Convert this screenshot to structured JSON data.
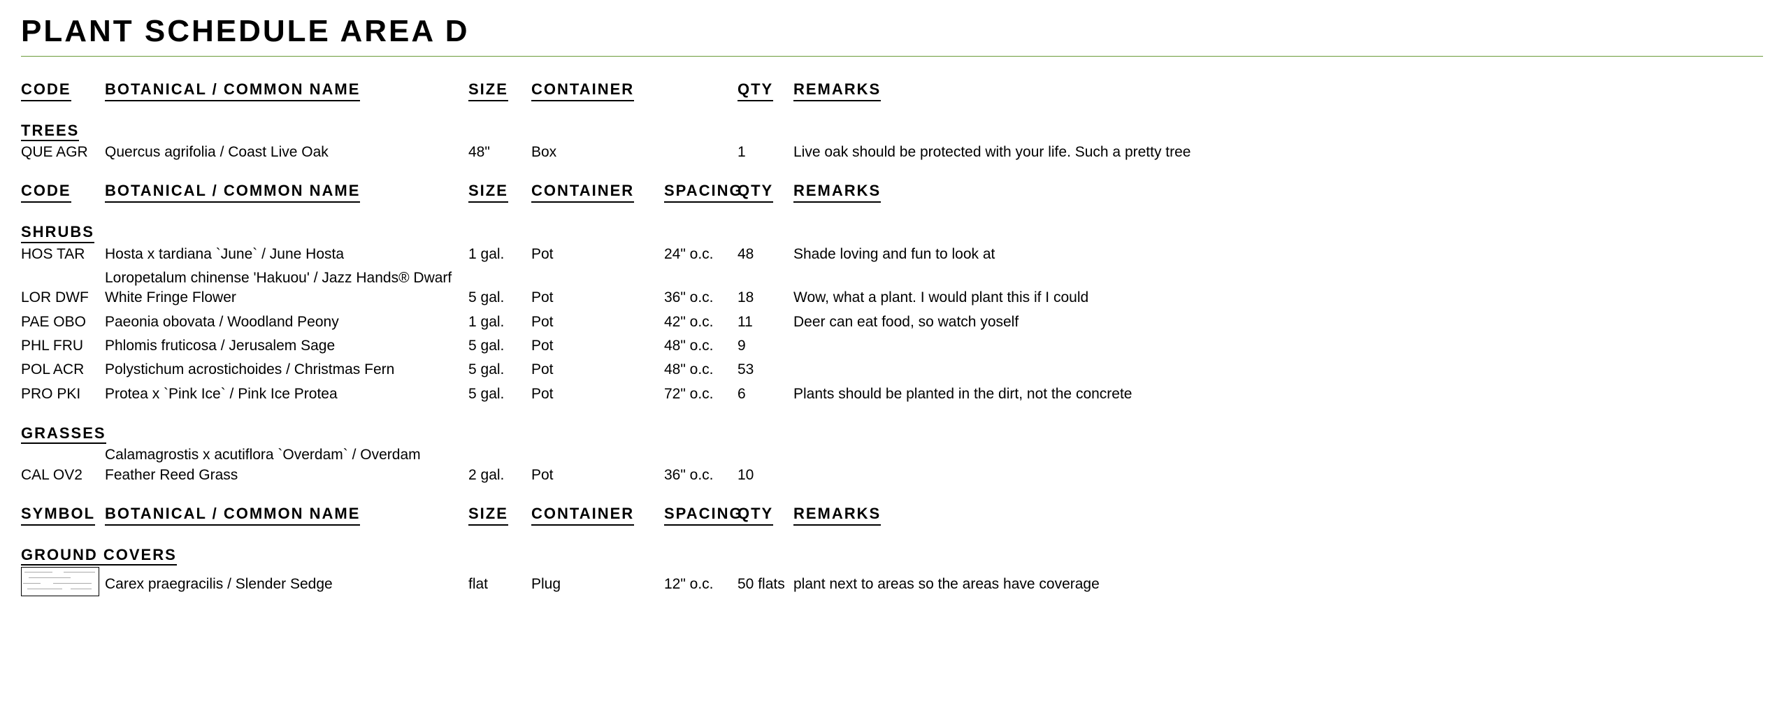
{
  "title": "PLANT SCHEDULE AREA D",
  "headers": {
    "code": "CODE",
    "symbol": "SYMBOL",
    "name": "BOTANICAL / COMMON NAME",
    "size": "SIZE",
    "container": "CONTAINER",
    "spacing": "SPACING",
    "qty": "QTY",
    "remarks": "REMARKS"
  },
  "sections": {
    "trees": {
      "label": "TREES",
      "rows": [
        {
          "code": "QUE AGR",
          "name": "Quercus agrifolia / Coast Live Oak",
          "size": "48\"",
          "container": "Box",
          "spacing": "",
          "qty": "1",
          "remarks": "Live oak should be protected with your life. Such a pretty tree"
        }
      ]
    },
    "shrubs": {
      "label": "SHRUBS",
      "rows": [
        {
          "code": "HOS TAR",
          "name": "Hosta x tardiana `June` / June Hosta",
          "size": "1 gal.",
          "container": "Pot",
          "spacing": "24\" o.c.",
          "qty": "48",
          "remarks": "Shade loving and fun to look at"
        },
        {
          "code": "LOR DWF",
          "name": "Loropetalum chinense 'Hakuou' / Jazz Hands® Dwarf White Fringe Flower",
          "size": "5 gal.",
          "container": "Pot",
          "spacing": "36\" o.c.",
          "qty": "18",
          "remarks": "Wow, what a plant. I would plant this if I could"
        },
        {
          "code": "PAE OBO",
          "name": "Paeonia obovata / Woodland Peony",
          "size": "1 gal.",
          "container": "Pot",
          "spacing": "42\" o.c.",
          "qty": "11",
          "remarks": "Deer can eat food, so watch yoself"
        },
        {
          "code": "PHL FRU",
          "name": "Phlomis fruticosa / Jerusalem Sage",
          "size": "5 gal.",
          "container": "Pot",
          "spacing": "48\" o.c.",
          "qty": "9",
          "remarks": ""
        },
        {
          "code": "POL ACR",
          "name": "Polystichum acrostichoides / Christmas Fern",
          "size": "5 gal.",
          "container": "Pot",
          "spacing": "48\" o.c.",
          "qty": "53",
          "remarks": ""
        },
        {
          "code": "PRO PKI",
          "name": "Protea x `Pink Ice` / Pink Ice Protea",
          "size": "5 gal.",
          "container": "Pot",
          "spacing": "72\" o.c.",
          "qty": "6",
          "remarks": "Plants should be planted in the dirt, not the concrete"
        }
      ]
    },
    "grasses": {
      "label": "GRASSES",
      "rows": [
        {
          "code": "CAL OV2",
          "name": "Calamagrostis x acutiflora `Overdam` / Overdam Feather Reed Grass",
          "size": "2 gal.",
          "container": "Pot",
          "spacing": "36\" o.c.",
          "qty": "10",
          "remarks": ""
        }
      ]
    },
    "ground_covers": {
      "label": "GROUND COVERS",
      "rows": [
        {
          "code": "",
          "name": "Carex praegracilis / Slender Sedge",
          "size": "flat",
          "container": "Plug",
          "spacing": "12\" o.c.",
          "qty": "50 flats",
          "remarks": "plant next to areas so the areas have coverage"
        }
      ]
    }
  }
}
